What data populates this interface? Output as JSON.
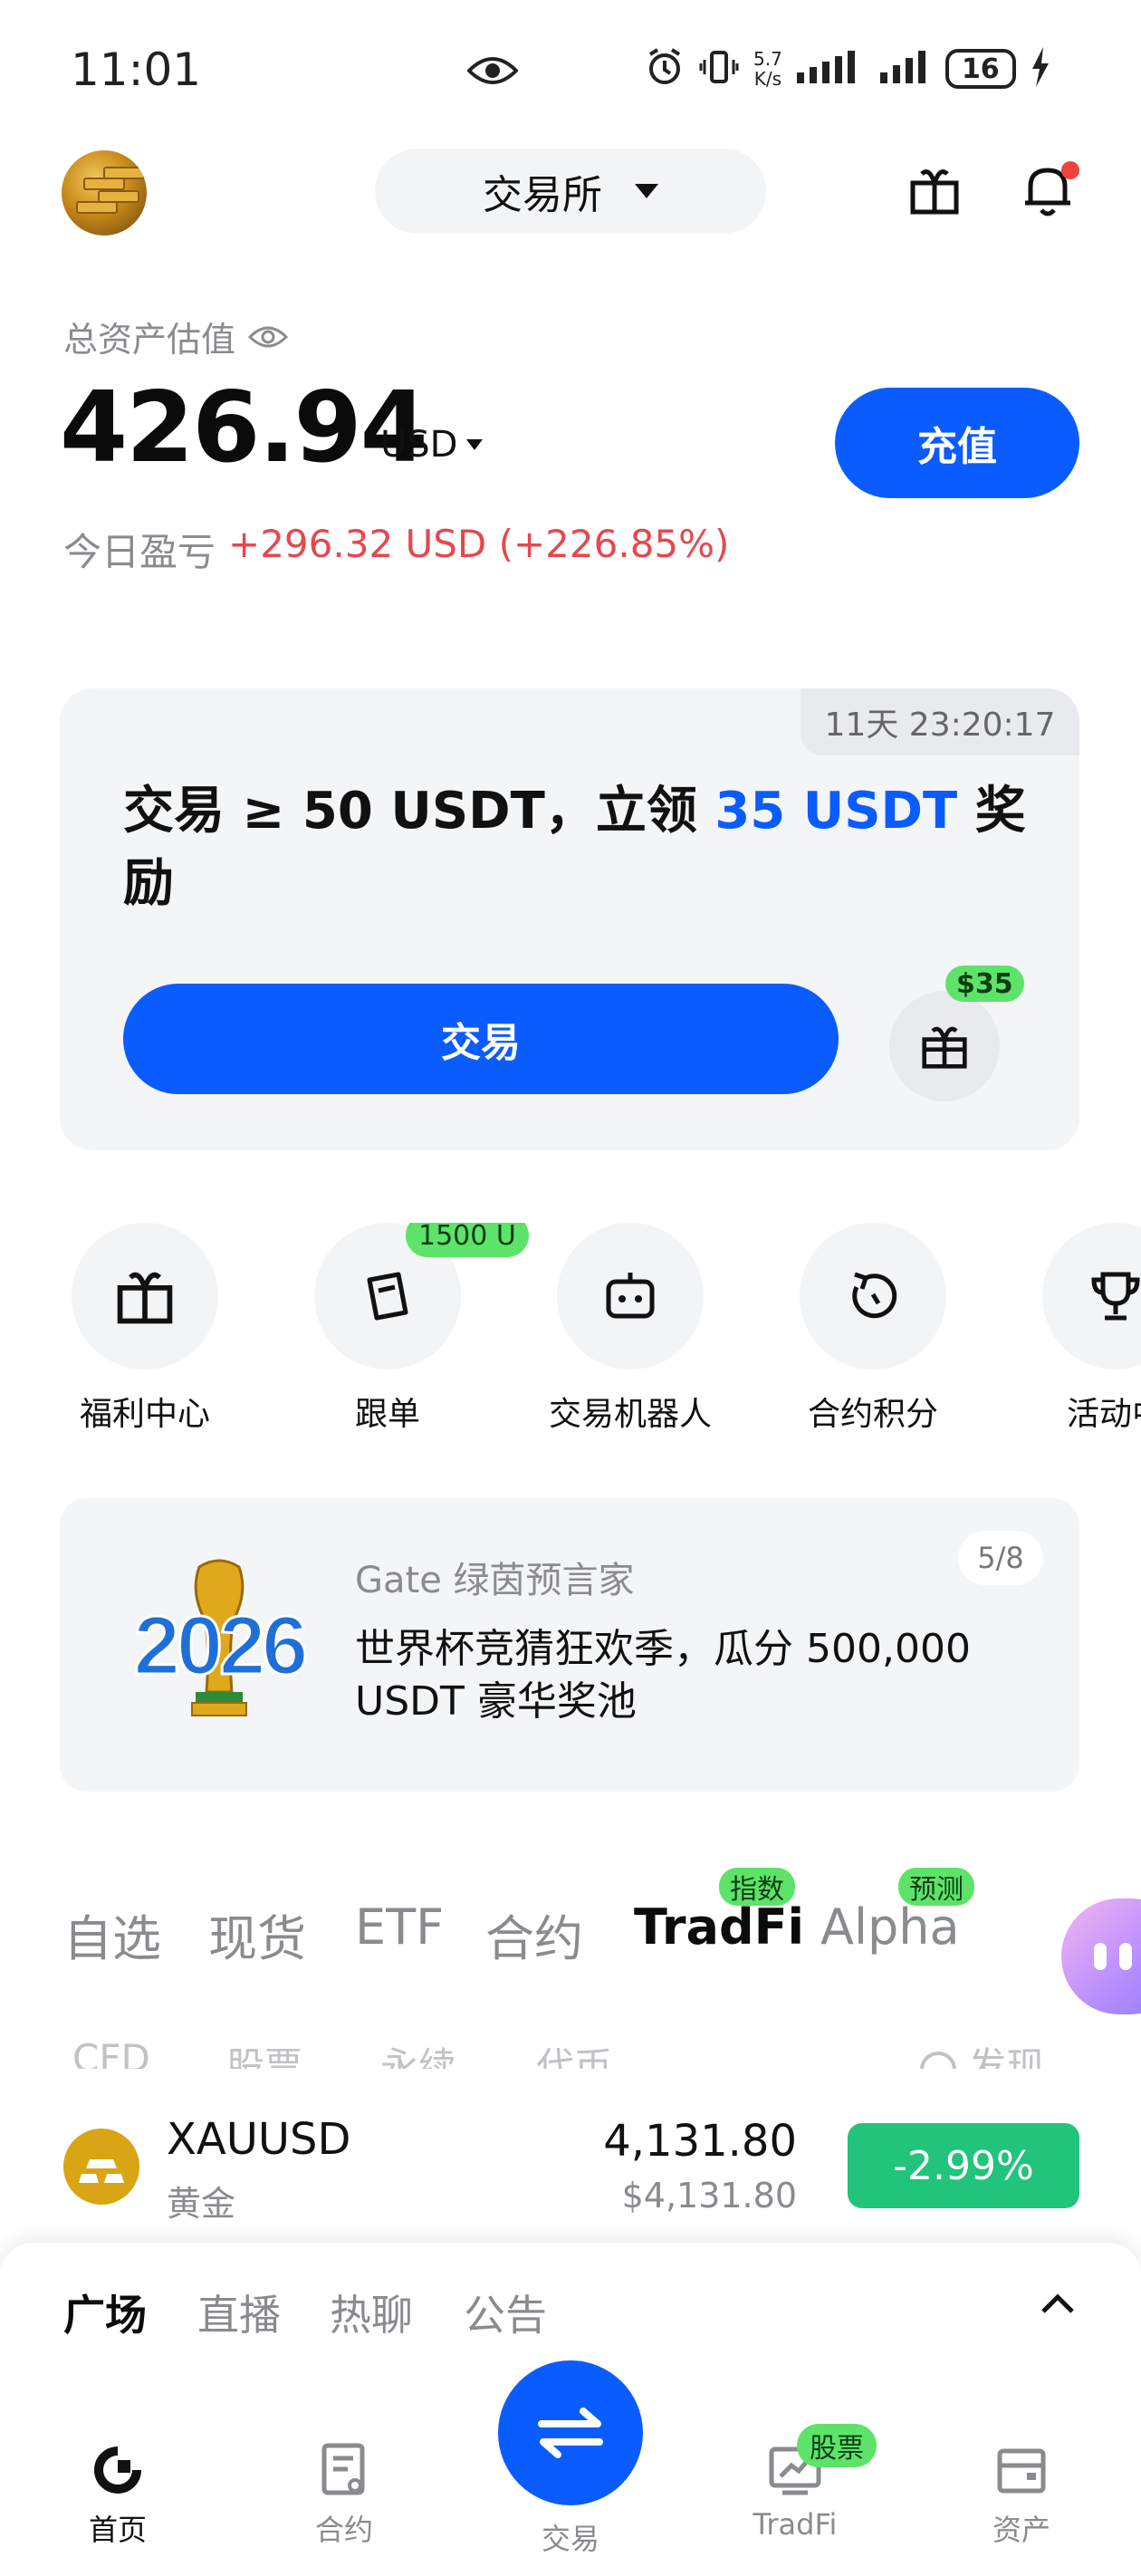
{
  "status_bar": {
    "time": "11:01",
    "net_speed_value": "5.7",
    "net_speed_unit": "K/s",
    "battery": "16"
  },
  "header": {
    "exchange_label": "交易所"
  },
  "assets": {
    "label": "总资产估值",
    "value": "426.94",
    "currency": "USD",
    "deposit_label": "充值",
    "pnl_label": "今日盈亏",
    "pnl_value": "+296.32 USD (+226.85%)"
  },
  "promo": {
    "timer": "11天 23:20:17",
    "title_prefix": "交易 ≥ 50 USDT，立领 ",
    "title_highlight": "35 USDT",
    "title_suffix": " 奖励",
    "trade_label": "交易",
    "gift_badge": "$35"
  },
  "shortcuts": [
    {
      "label": "福利中心",
      "icon": "gift-icon"
    },
    {
      "label": "跟单",
      "icon": "copy-trade-icon",
      "badge": "1500 U"
    },
    {
      "label": "交易机器人",
      "icon": "robot-icon"
    },
    {
      "label": "合约积分",
      "icon": "refresh-points-icon"
    },
    {
      "label": "活动中",
      "icon": "trophy-icon"
    }
  ],
  "banner": {
    "subtitle": "Gate 绿茵预言家",
    "text": "世界杯竞猜狂欢季，瓜分 500,000 USDT 豪华奖池",
    "page": "5/8",
    "logo_text": "2026"
  },
  "market_tabs": [
    {
      "label": "自选"
    },
    {
      "label": "现货"
    },
    {
      "label": "ETF"
    },
    {
      "label": "合约"
    },
    {
      "label": "TradFi",
      "badge": "指数",
      "active": true
    },
    {
      "label": "Alpha",
      "badge": "预测"
    }
  ],
  "sub_tabs": [
    "CFD",
    "股票",
    "永续",
    "代币",
    "发现"
  ],
  "asset_row": {
    "symbol": "XAUUSD",
    "name": "黄金",
    "price": "4,131.80",
    "price_usd": "$4,131.80",
    "change": "-2.99%"
  },
  "feed_tabs": [
    "广场",
    "直播",
    "热聊",
    "公告"
  ],
  "bottom_nav": {
    "home": "首页",
    "futures": "合约",
    "trade": "交易",
    "tradfi": "TradFi",
    "tradfi_badge": "股票",
    "assets": "资产"
  },
  "colors": {
    "primary": "#0a5cff",
    "positive": "#e5484d",
    "negative_change": "#21c47a",
    "badge_green": "#5ee36a"
  }
}
